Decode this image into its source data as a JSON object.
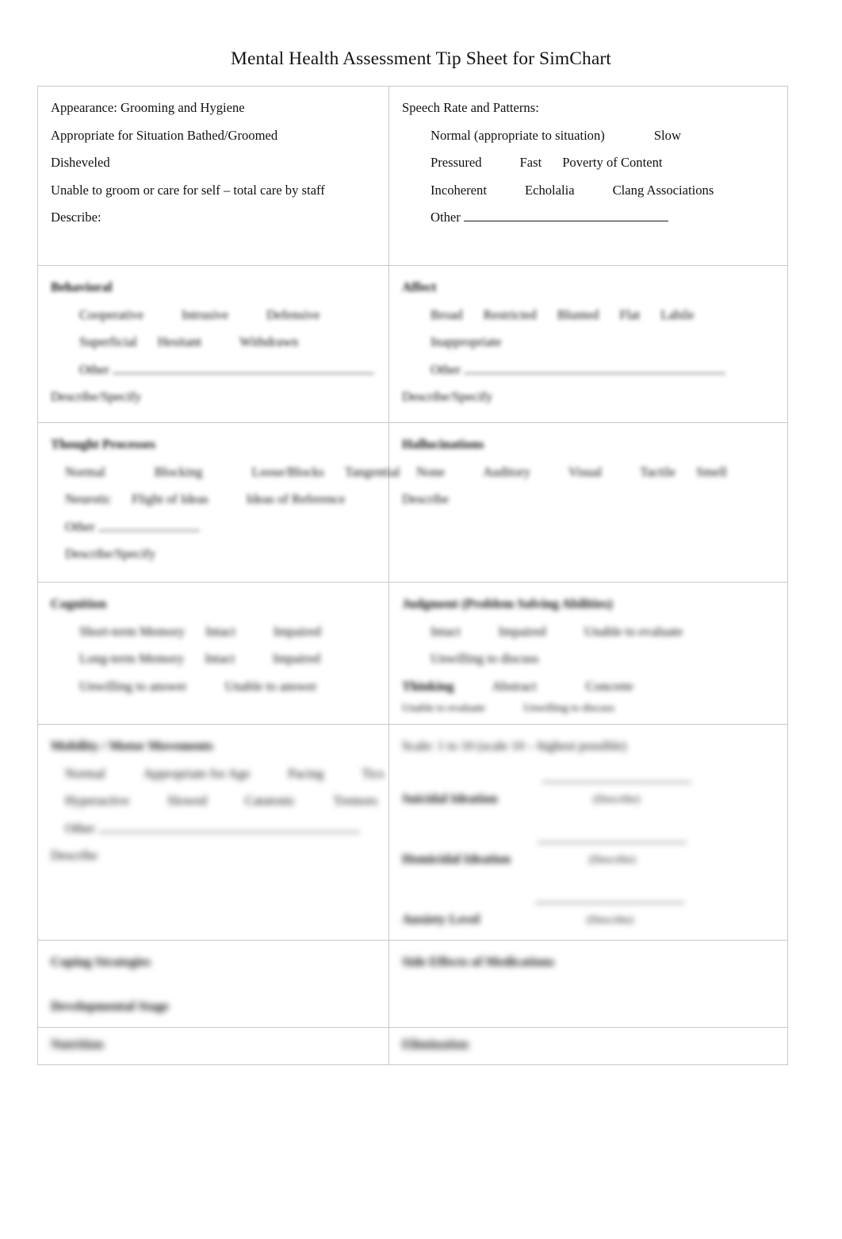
{
  "document": {
    "title": "Mental Health Assessment Tip Sheet for SimChart"
  },
  "sections": {
    "appearance": {
      "heading": "Appearance:  Grooming and Hygiene",
      "line2": "Appropriate for Situation   Bathed/Groomed",
      "line3": "Disheveled",
      "line4": "Unable to groom or care for self – total care by staff",
      "describe": "Describe:"
    },
    "speech": {
      "heading": "Speech Rate and Patterns:",
      "opt_normal": "Normal (appropriate to situation)",
      "opt_slow": "Slow",
      "opt_pressured": "Pressured",
      "opt_fast": "Fast",
      "opt_poverty": "Poverty of Content",
      "opt_incoherent": "Incoherent",
      "opt_echolalia": "Echolalia",
      "opt_clang": "Clang Associations",
      "opt_other": "Other"
    },
    "behavior": {
      "heading": "Behavioral",
      "opt_cooperative": "Cooperative",
      "opt_intrusive": "Intrusive",
      "opt_defensive": "Defensive",
      "opt_superficial": "Superficial",
      "opt_hesitant": "Hesitant",
      "opt_withdrawn": "Withdrawn",
      "opt_other": "Other",
      "describe": "Describe/Specify"
    },
    "affect": {
      "heading": "Affect",
      "opt_broad": "Broad",
      "opt_restricted": "Restricted",
      "opt_blunted": "Blunted",
      "opt_flat": "Flat",
      "opt_labile": "Labile",
      "opt_inappropriate": "Inappropriate",
      "opt_other": "Other",
      "describe": "Describe/Specify"
    },
    "thought_processes": {
      "heading": "Thought Processes",
      "opt_normal": "Normal",
      "opt_blocking": "Blocking",
      "opt_loose": "Loose/Blocks",
      "opt_tangential": "Tangential",
      "opt_neologism": "Neurotic",
      "opt_flight": "Flight of Ideas",
      "opt_ideas_ref": "Ideas of Reference",
      "opt_other": "Other",
      "describe": "Describe/Specify"
    },
    "hallucinations": {
      "heading": "Hallucinations",
      "opt_none": "None",
      "opt_auditory": "Auditory",
      "opt_visual": "Visual",
      "opt_tactile": "Tactile",
      "opt_smell": "Smell",
      "describe": "Describe"
    },
    "cognition": {
      "heading": "Cognition",
      "row1_label": "Short-term Memory",
      "row1_a": "Intact",
      "row1_b": "Impaired",
      "row2_label": "Long-term Memory",
      "row2_a": "Intact",
      "row2_b": "Impaired",
      "row3_a": "Unwilling to answer",
      "row3_b": "Unable to answer"
    },
    "judgment": {
      "heading": "Judgment (Problem Solving Abilities)",
      "opt_intact": "Intact",
      "opt_impaired": "Impaired",
      "opt_unable_eval": "Unable to evaluate",
      "opt_unwilling": "Unwilling to discuss",
      "thinking_label": "Thinking",
      "thinking_a": "Abstract",
      "thinking_b": "Concrete",
      "note_a": "Unable to evaluate",
      "note_b": "Unwilling to discuss",
      "scale": "Scale:   1 to 10    (scale 10 – highest possible)",
      "suicidal_label": "Suicidal Ideation",
      "suicidal_caption": "(Describe)",
      "homicidal_label": "Homicidal Ideation",
      "homicidal_caption": "(Describe)",
      "anxiety_label": "Anxiety Level",
      "anxiety_caption": "(Describe)"
    },
    "mobility": {
      "heading": "Mobility / Motor Movements",
      "opt_normal": "Normal",
      "opt_appropriate": "Appropriate for Age",
      "opt_pacing": "Pacing",
      "opt_tics": "Tics",
      "opt_hyperactive": "Hyperactive",
      "opt_slowed": "Slowed",
      "opt_catatonic": "Catatonic",
      "opt_tremors": "Tremors",
      "opt_other": "Other",
      "describe": "Describe"
    },
    "coping": {
      "heading": "Coping Strategies"
    },
    "developmental": {
      "heading": "Developmental Stage"
    },
    "side_effects": {
      "heading": "Side Effects of Medications"
    },
    "nutrition": {
      "heading": "Nutrition"
    },
    "elimination": {
      "heading": "Elimination"
    }
  }
}
